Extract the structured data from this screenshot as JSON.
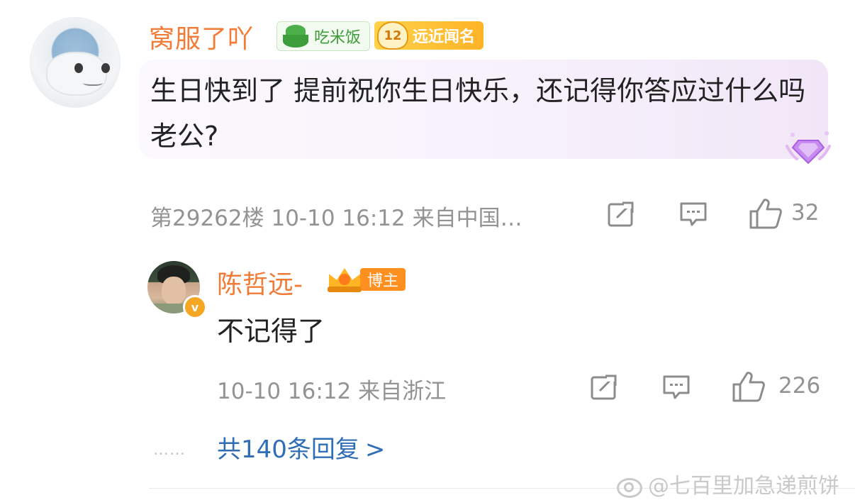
{
  "comment": {
    "username": "窝服了吖",
    "badge_rice_label": "吃米饭",
    "badge_fame_level": "12",
    "badge_fame_label": "远近闻名",
    "text": "生日快到了 提前祝你生日快乐，还记得你答应过什么吗老公?",
    "meta": "第29262楼 10-10 16:12 来自中国…",
    "like_count": "32"
  },
  "reply": {
    "username": "陈哲远-",
    "badge_blogger_label": "博主",
    "text": "不记得了",
    "meta": "10-10 16:12 来自浙江",
    "like_count": "226"
  },
  "more": {
    "dots": "……",
    "label": "共140条回复",
    "chevron": ">"
  },
  "watermark": {
    "text": "@七百里加急递煎饼"
  },
  "colors": {
    "username": "#f27b36",
    "link": "#2f6db5",
    "meta": "#939393",
    "text": "#222222"
  },
  "icons": [
    "share-icon",
    "comment-icon",
    "like-icon",
    "verified-icon",
    "gem-icon",
    "rice-bowl-icon",
    "crown-icon",
    "weibo-logo-icon"
  ]
}
